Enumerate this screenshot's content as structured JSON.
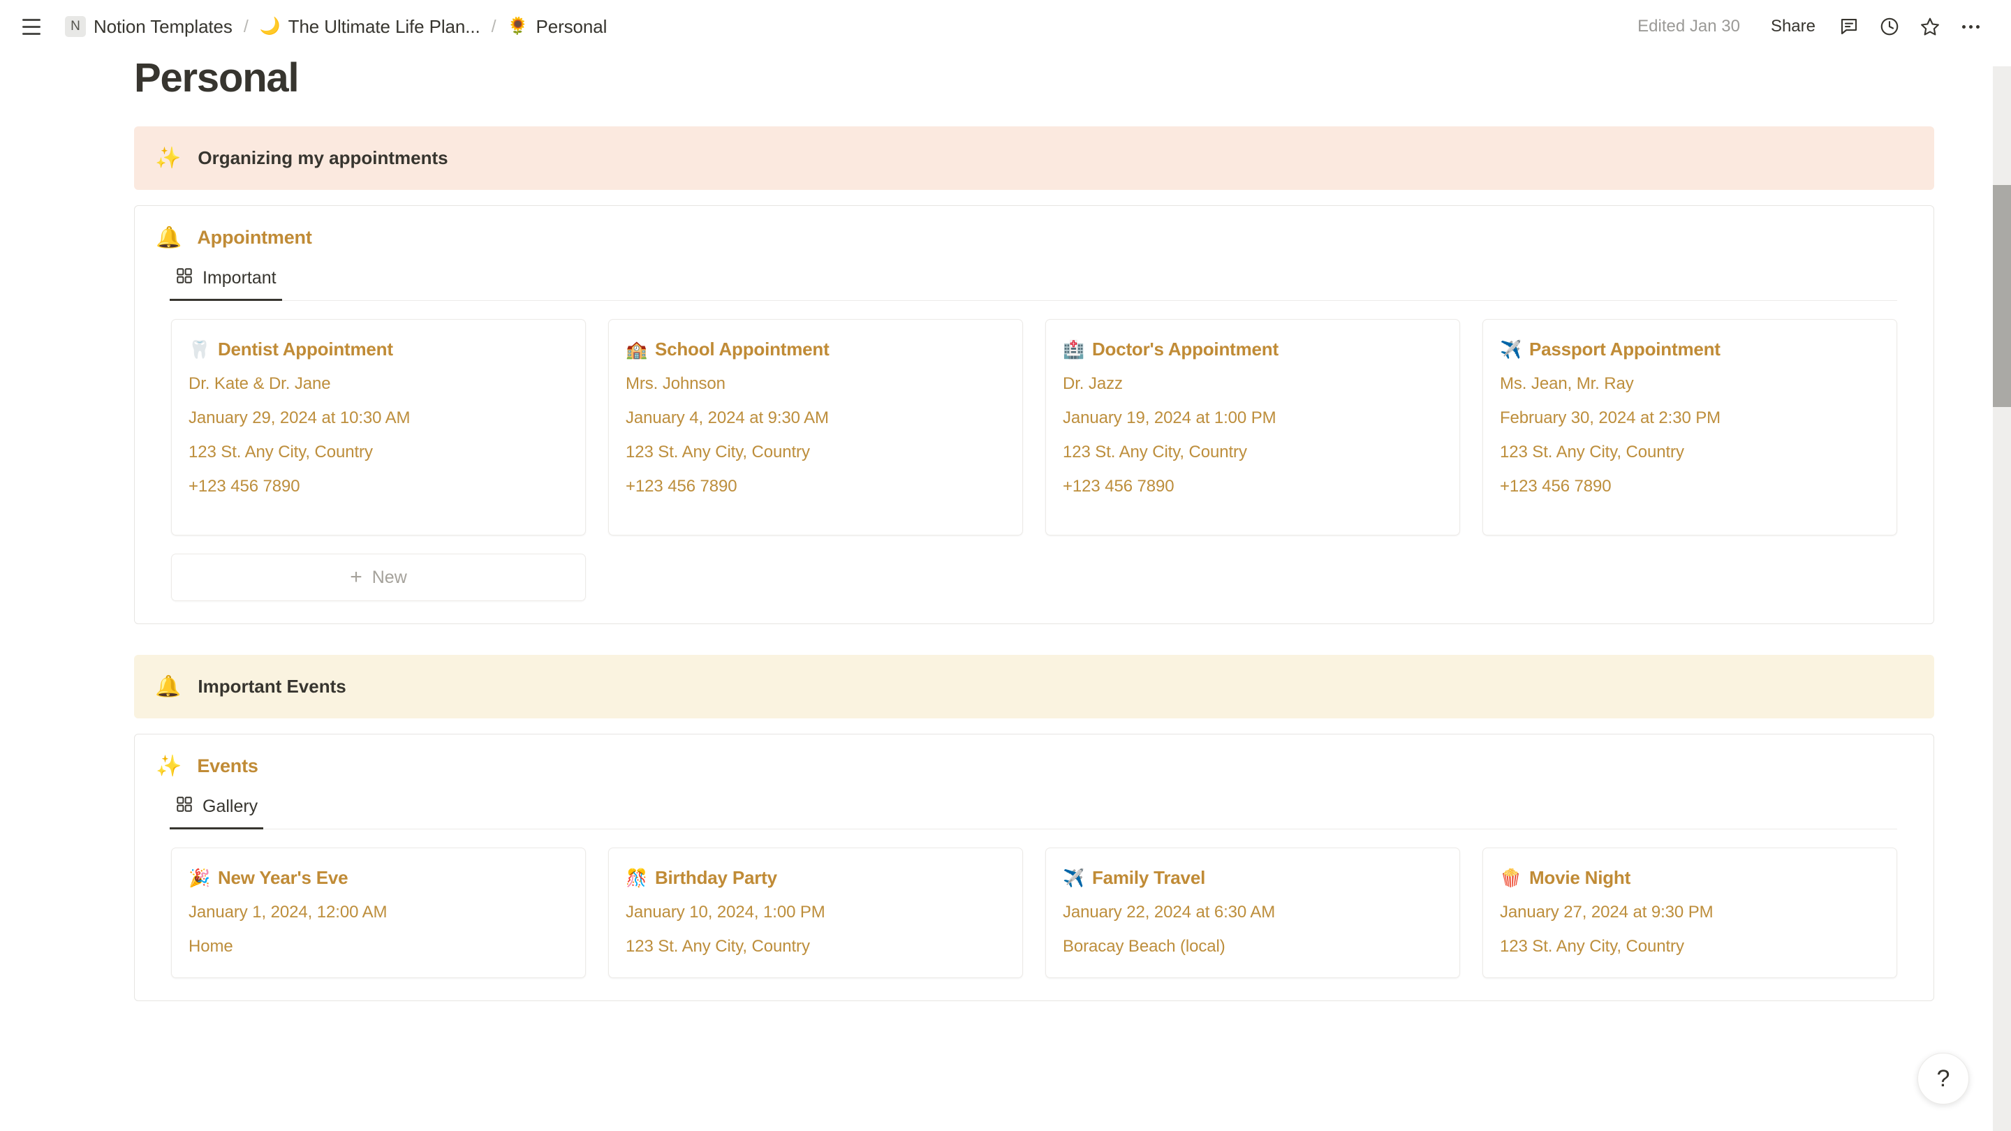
{
  "topbar": {
    "menu_icon": "hamburger-icon",
    "breadcrumbs": [
      {
        "icon": "N",
        "label": "Notion Templates",
        "type": "workspace"
      },
      {
        "icon": "🌙",
        "label": "The Ultimate Life Plan...",
        "type": "page"
      },
      {
        "icon": "🌻",
        "label": "Personal",
        "type": "page"
      }
    ],
    "separator": "/",
    "edited_label": "Edited Jan 30",
    "share_label": "Share",
    "actions": [
      "comment-icon",
      "history-icon",
      "star-icon",
      "more-options-icon"
    ]
  },
  "page": {
    "title": "Personal"
  },
  "callouts": {
    "appointments": {
      "icon": "✨",
      "text": "Organizing my appointments",
      "color": "#fbe9df"
    },
    "events": {
      "icon": "🔔",
      "text": "Important Events",
      "color": "#faf3e0"
    }
  },
  "appointment_db": {
    "icon": "🔔",
    "title": "Appointment",
    "tab": {
      "label": "Important",
      "icon": "gallery-view-icon"
    },
    "new_label": "New",
    "cards": [
      {
        "emoji": "🦷",
        "title": "Dentist Appointment",
        "person": "Dr. Kate & Dr. Jane",
        "datetime": "January 29, 2024 at 10:30 AM",
        "address": "123 St. Any City, Country",
        "phone": "+123 456 7890"
      },
      {
        "emoji": "🏫",
        "title": "School Appointment",
        "person": "Mrs. Johnson",
        "datetime": "January 4, 2024 at 9:30 AM",
        "address": "123 St. Any City, Country",
        "phone": "+123 456 7890"
      },
      {
        "emoji": "🏥",
        "title": "Doctor's Appointment",
        "person": "Dr. Jazz",
        "datetime": "January 19, 2024 at 1:00 PM",
        "address": "123 St. Any City, Country",
        "phone": "+123 456 7890"
      },
      {
        "emoji": "✈️",
        "title": "Passport Appointment",
        "person": "Ms. Jean, Mr. Ray",
        "datetime": "February 30, 2024 at 2:30 PM",
        "address": "123 St. Any City, Country",
        "phone": "+123 456 7890"
      }
    ]
  },
  "events_db": {
    "icon": "✨",
    "title": "Events",
    "tab": {
      "label": "Gallery",
      "icon": "gallery-view-icon"
    },
    "cards": [
      {
        "emoji": "🎉",
        "title": "New Year's Eve",
        "datetime": "January 1, 2024, 12:00 AM",
        "location": "Home"
      },
      {
        "emoji": "🎊",
        "title": "Birthday Party",
        "datetime": "January 10, 2024, 1:00 PM",
        "location": "123 St. Any City, Country"
      },
      {
        "emoji": "✈️",
        "title": "Family Travel",
        "datetime": "January 22, 2024 at 6:30 AM",
        "location": "Boracay Beach (local)"
      },
      {
        "emoji": "🍿",
        "title": "Movie Night",
        "datetime": "January 27, 2024 at 9:30 PM",
        "location": "123 St. Any City, Country"
      }
    ]
  },
  "help": {
    "label": "?"
  },
  "colors": {
    "accent_gold": "#c08b36",
    "text_primary": "#37352f",
    "text_muted": "#9b9a97",
    "callout_orange": "#fbe9df",
    "callout_yellow": "#faf3e0"
  }
}
